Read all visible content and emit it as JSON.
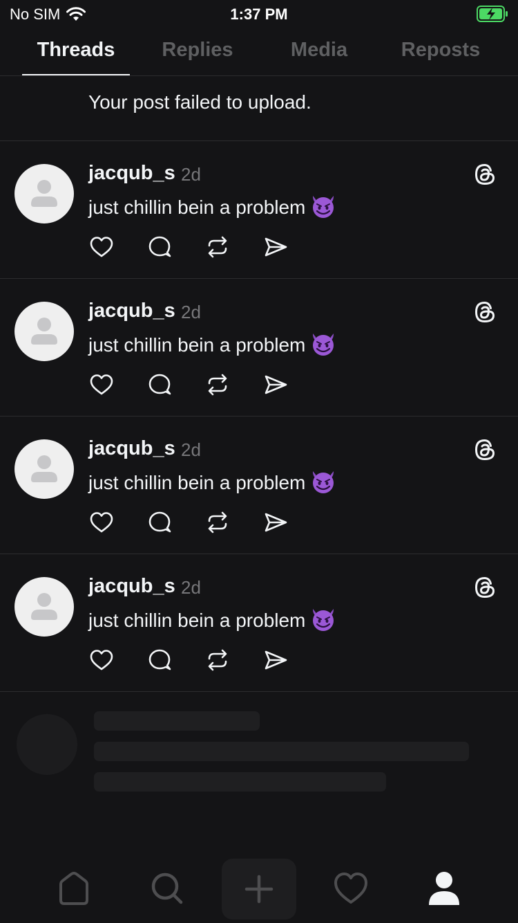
{
  "status_bar": {
    "carrier": "No SIM",
    "time": "1:37 PM"
  },
  "tabs": [
    {
      "label": "Threads",
      "active": true
    },
    {
      "label": "Replies",
      "active": false
    },
    {
      "label": "Media",
      "active": false
    },
    {
      "label": "Reposts",
      "active": false
    }
  ],
  "banner": {
    "message": "Your post failed to upload."
  },
  "posts": [
    {
      "username": "jacqub_s",
      "age": "2d",
      "text": "just chillin bein a problem"
    },
    {
      "username": "jacqub_s",
      "age": "2d",
      "text": "just chillin bein a problem"
    },
    {
      "username": "jacqub_s",
      "age": "2d",
      "text": "just chillin bein a problem"
    },
    {
      "username": "jacqub_s",
      "age": "2d",
      "text": "just chillin bein a problem"
    }
  ],
  "post_actions": [
    "heart-icon",
    "comment-icon",
    "repost-icon",
    "share-icon"
  ],
  "nav": [
    "home-icon",
    "search-icon",
    "plus-icon",
    "heart-icon",
    "profile-icon"
  ],
  "colors": {
    "background": "#141416",
    "text": "#f3f5f7",
    "muted": "#5f6062",
    "battery": "#4cd964"
  }
}
